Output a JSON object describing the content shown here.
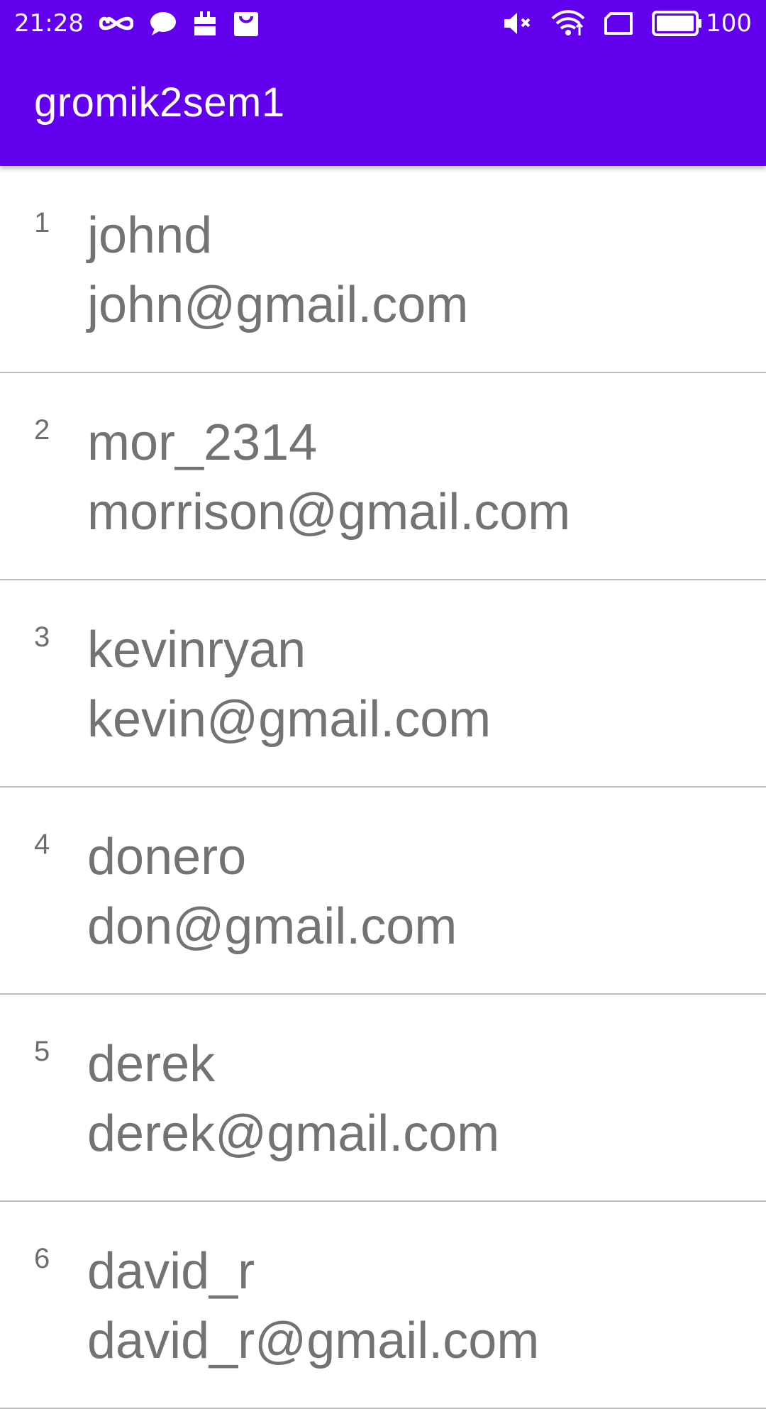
{
  "status_bar": {
    "time": "21:28",
    "battery_level": "100",
    "left_icons": [
      "infinity-icon",
      "chat-bubble-icon",
      "briefcase-icon",
      "shopping-bag-icon"
    ],
    "right_icons": [
      "volume-muted-icon",
      "wifi-icon",
      "screen-rotation-icon",
      "battery-icon"
    ]
  },
  "app_bar": {
    "title": "gromik2sem1",
    "background_color": "#6200ee"
  },
  "users": [
    {
      "index": "1",
      "username": "johnd",
      "email": "john@gmail.com"
    },
    {
      "index": "2",
      "username": "mor_2314",
      "email": "morrison@gmail.com"
    },
    {
      "index": "3",
      "username": "kevinryan",
      "email": "kevin@gmail.com"
    },
    {
      "index": "4",
      "username": "donero",
      "email": "don@gmail.com"
    },
    {
      "index": "5",
      "username": "derek",
      "email": "derek@gmail.com"
    },
    {
      "index": "6",
      "username": "david_r",
      "email": "david_r@gmail.com"
    }
  ]
}
